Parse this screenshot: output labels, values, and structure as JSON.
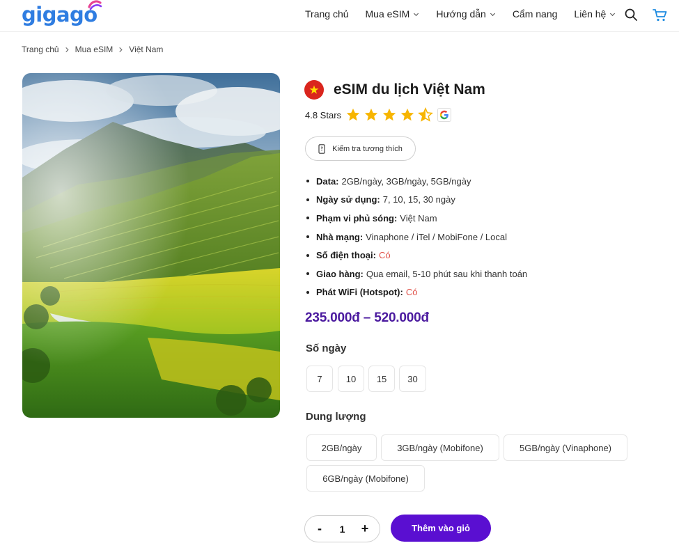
{
  "brand": {
    "logo_text": "gigago"
  },
  "nav": {
    "items": [
      {
        "label": "Trang chủ",
        "dropdown": false
      },
      {
        "label": "Mua eSIM",
        "dropdown": true
      },
      {
        "label": "Hướng dẫn",
        "dropdown": true
      },
      {
        "label": "Cẩm nang",
        "dropdown": false
      },
      {
        "label": "Liên hệ",
        "dropdown": true
      }
    ],
    "icons": [
      "search-icon",
      "cart-icon"
    ]
  },
  "breadcrumb": [
    "Trang chủ",
    "Mua eSIM",
    "Việt Nam"
  ],
  "product": {
    "title": "eSIM du lịch Việt Nam",
    "rating_text": "4.8 Stars",
    "rating_value": 4.8,
    "check_label": "Kiểm tra tương thích",
    "specs": [
      {
        "key": "Data:",
        "value": "2GB/ngày, 3GB/ngày, 5GB/ngày",
        "highlight": false
      },
      {
        "key": "Ngày sử dụng:",
        "value": "7, 10, 15, 30 ngày",
        "highlight": false
      },
      {
        "key": "Phạm vi phủ sóng:",
        "value": "Việt Nam",
        "highlight": false
      },
      {
        "key": "Nhà mạng:",
        "value": "Vinaphone / iTel / MobiFone / Local",
        "highlight": false
      },
      {
        "key": "Số điện thoại:",
        "value": "Có",
        "highlight": true
      },
      {
        "key": "Giao hàng:",
        "value": "Qua email, 5-10 phút sau khi thanh toán",
        "highlight": false
      },
      {
        "key": "Phát WiFi (Hotspot):",
        "value": "Có",
        "highlight": true
      }
    ],
    "price": "235.000đ – 520.000đ",
    "days_label": "Số ngày",
    "days_options": [
      "7",
      "10",
      "15",
      "30"
    ],
    "data_label": "Dung lượng",
    "data_options": [
      "2GB/ngày",
      "3GB/ngày (Mobifone)",
      "5GB/ngày (Vinaphone)",
      "6GB/ngày (Mobifone)"
    ],
    "quantity": "1",
    "qty_minus": "-",
    "qty_plus": "+",
    "add_to_cart": "Thêm vào giỏ"
  },
  "colors": {
    "brand_blue": "#2f7de1",
    "price_purple": "#4b1a9f",
    "button_purple": "#5a0fd1",
    "star_yellow": "#f7b500",
    "highlight_red": "#e0524a"
  }
}
